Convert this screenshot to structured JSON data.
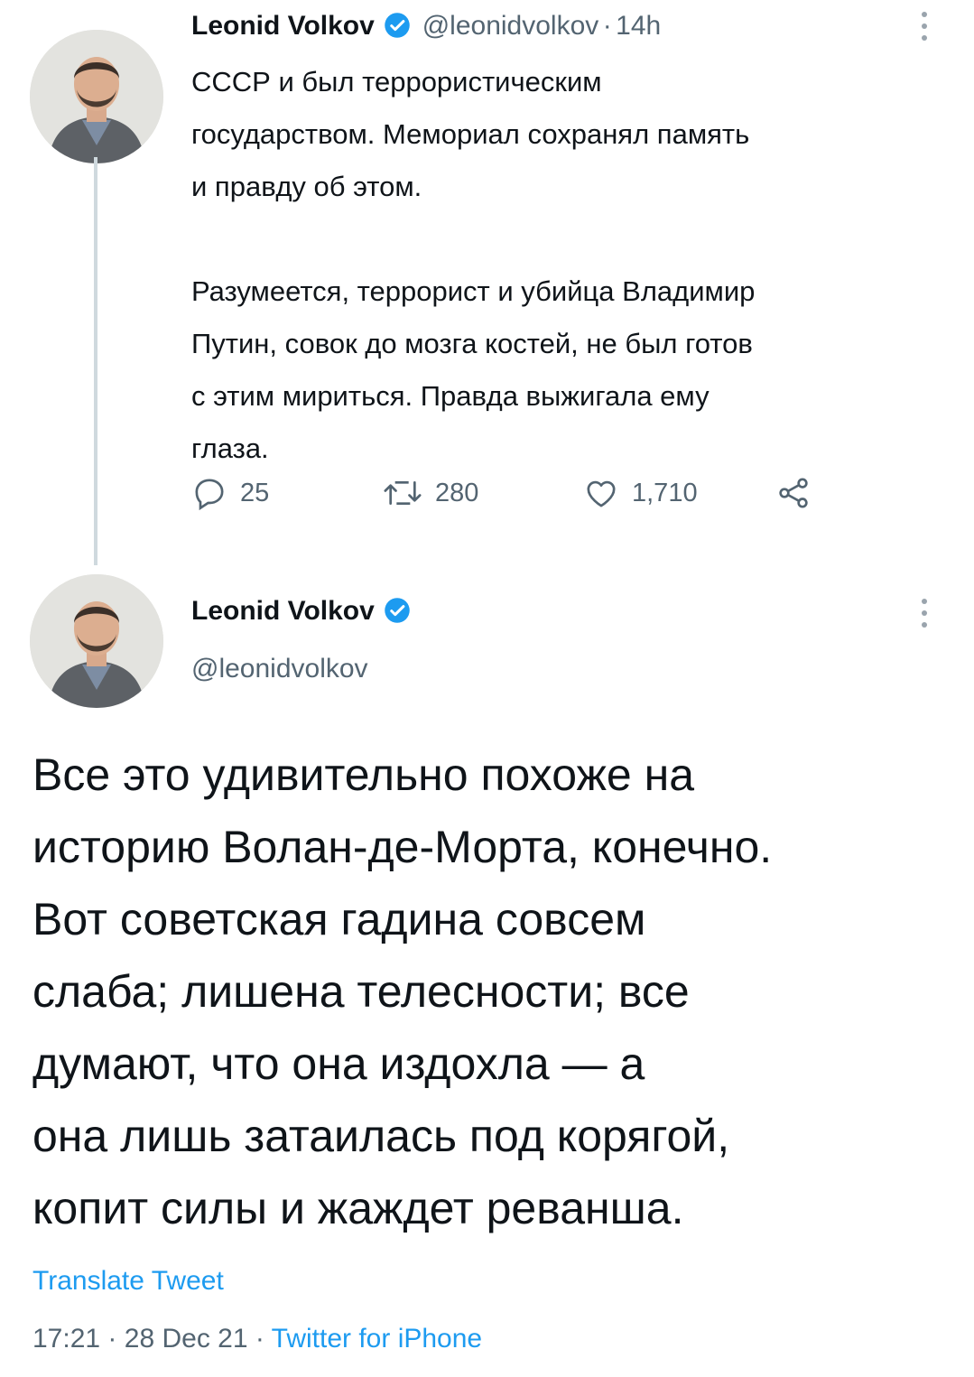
{
  "tweet1": {
    "author_name": "Leonid Volkov",
    "handle": "@leonidvolkov",
    "separator": "·",
    "time_ago": "14h",
    "text": "СССР и был террористическим\nгосударством. Мемориал сохранял память\nи правду об этом.\n\nРазумеется, террорист и убийца Владимир\nПутин, совок до мозга костей, не был готов\nс этим мириться. Правда выжигала ему\nглаза.",
    "replies": "25",
    "retweets": "280",
    "likes": "1,710",
    "icons": [
      "reply-icon",
      "retweet-icon",
      "like-icon",
      "share-icon",
      "more-icon",
      "verified-badge-icon"
    ]
  },
  "tweet2": {
    "author_name": "Leonid Volkov",
    "handle": "@leonidvolkov",
    "text": "Все это удивительно похоже на\nисторию Волан-де-Морта, конечно.\nВот советская гадина совсем\nслаба; лишена телесности; все\nдумают, что она издохла — а\nона лишь затаилась под корягой,\nкопит силы и жаждет реванша.",
    "translate_label": "Translate Tweet",
    "time": "17:21",
    "date": "28 Dec 21",
    "separator": "·",
    "source": "Twitter for iPhone"
  },
  "colors": {
    "accent": "#1d9bf0",
    "secondary_text": "#536471",
    "primary_text": "#0f1419",
    "thread_line": "#cfd9de"
  }
}
